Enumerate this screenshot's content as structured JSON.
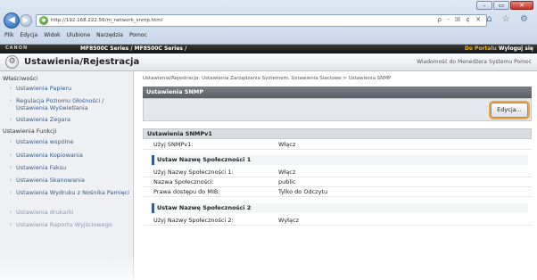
{
  "browser": {
    "url": "http://192.168.222.56/m_network_snmp.html",
    "address_tools": "ρ - ☒ ¢ ✕",
    "window_controls": [
      "–",
      "▭",
      "✕"
    ],
    "toolbar_icons": "⌂ ☆ ⚙",
    "menu": [
      "Plik",
      "Edycja",
      "Widok",
      "Ulubione",
      "Narzędzia",
      "Pomoc"
    ]
  },
  "printer_bar": {
    "logo": "CANON",
    "model": "MF8500C Series / MF8500C Series /",
    "portal_link": "Do Portalu",
    "logout": "Wyloguj się"
  },
  "page": {
    "title": "Ustawienia/Rejestracja",
    "title_icon": "settings-icon",
    "header_links": "Wiadomość do Menedżera Systemu  Pomoc"
  },
  "sidebar": {
    "sections": [
      {
        "heading": "Właściwości",
        "items": [
          "Ustawienia Papieru",
          "Regulacja Poziomu Głośności / Ustawienia Wyświetlania",
          "Ustawienia Zegara"
        ]
      },
      {
        "heading": "Ustawienia Funkcji",
        "items": [
          "Ustawienia wspólne",
          "Ustawienia Kopiowania",
          "Ustawienia Faksu",
          "Ustawienia Skanowania",
          "Ustawienia Wydruku z Nośnika Pamięci",
          "Ustawienia drukarki",
          "Ustawienia Raportu Wyjściowego"
        ]
      }
    ]
  },
  "main": {
    "breadcrumb": "Ustawienia/Rejestracja: Ustawienia Zarządzania Systemem: Ustawienia Sieciowe > Ustawienia SNMP",
    "panel_title": "Ustawienia SNMP",
    "edit_button": "Edycja...",
    "snmpv1": {
      "title": "Ustawienia SNMPv1",
      "rows": [
        {
          "label": "Użyj SNMPv1:",
          "value": "Włącz"
        }
      ]
    },
    "community1": {
      "title": "Ustaw Nazwę Społeczności 1",
      "rows": [
        {
          "label": "Użyj Nazwy Społeczności 1:",
          "value": "Włącz"
        },
        {
          "label": "Nazwa Społeczności:",
          "value": "public"
        },
        {
          "label": "Prawa dostępu do MIB:",
          "value": "Tylko do Odczytu"
        }
      ]
    },
    "community2": {
      "title": "Ustaw Nazwę Społeczności 2",
      "rows": [
        {
          "label": "Użyj Nazwy Społeczności 2:",
          "value": "Wyłącz"
        }
      ]
    }
  }
}
